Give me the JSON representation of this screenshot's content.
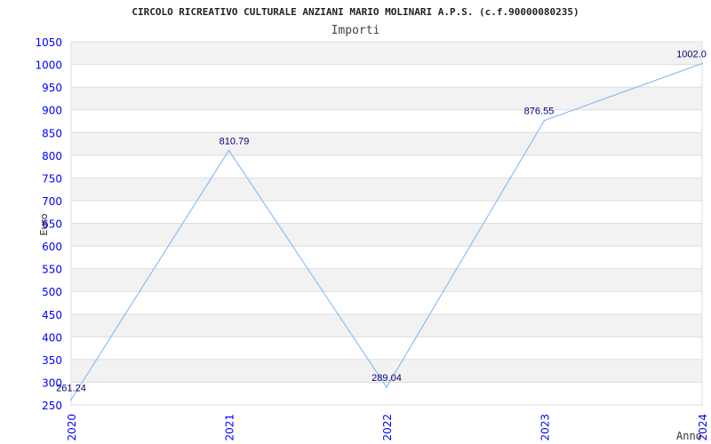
{
  "chart_data": {
    "type": "line",
    "title": "CIRCOLO RICREATIVO CULTURALE ANZIANI MARIO MOLINARI A.P.S. (c.f.90000080235)",
    "subtitle": "Importi",
    "xlabel": "Anno",
    "ylabel": "Euro",
    "categories": [
      "2020",
      "2021",
      "2022",
      "2023",
      "2024"
    ],
    "values": [
      261.24,
      810.79,
      289.04,
      876.55,
      1002.0
    ],
    "data_labels": [
      "261.24",
      "810.79",
      "289.04",
      "876.55",
      "1002.0"
    ],
    "ylim": [
      250,
      1050
    ],
    "yticks": [
      "250",
      "300",
      "350",
      "400",
      "450",
      "500",
      "550",
      "600",
      "650",
      "700",
      "750",
      "800",
      "850",
      "900",
      "950",
      "1000",
      "1050"
    ],
    "grid": true,
    "colors": {
      "line": "#7ab4f0",
      "tick_labels": "#0000ff",
      "data_labels": "#000080",
      "band": "#f2f2f2",
      "grid": "#dddddd"
    }
  }
}
